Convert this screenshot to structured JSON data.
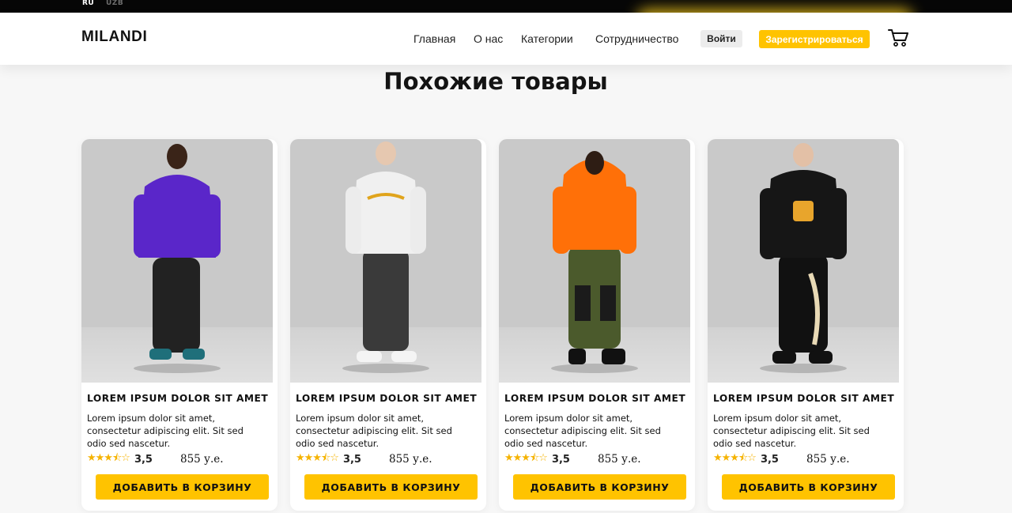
{
  "topbar": {
    "lang_ru": "RU",
    "lang_uz": "UZB"
  },
  "header": {
    "logo": "MILANDI",
    "nav": [
      "Главная",
      "О нас",
      "Категории",
      "Сотрудничество"
    ],
    "login_label": "Войти",
    "register_label": "Зарегистрироваться",
    "cart_icon": "shopping-cart-icon"
  },
  "colors": {
    "accent": "#ffc300",
    "star": "#f5b301",
    "topbar": "#060606"
  },
  "section": {
    "title": "Похожие товары"
  },
  "products": [
    {
      "image_desc": "purple hoodie",
      "title": "LOREM IPSUM DOLOR SIT AMET",
      "description": "Lorem ipsum dolor sit amet, consectetur adipiscing elit. Sit sed odio sed nascetur.",
      "stars": "★★★⯪☆",
      "rating": "3,5",
      "price": "855 у.е.",
      "button": "ДОБАВИТЬ В КОРЗИНУ"
    },
    {
      "image_desc": "white hoodie",
      "title": "LOREM IPSUM DOLOR SIT AMET",
      "description": "Lorem ipsum dolor sit amet, consectetur adipiscing elit. Sit sed odio sed nascetur.",
      "stars": "★★★⯪☆",
      "rating": "3,5",
      "price": "855 у.е.",
      "button": "ДОБАВИТЬ В КОРЗИНУ"
    },
    {
      "image_desc": "orange hoodie",
      "title": "LOREM IPSUM DOLOR SIT AMET",
      "description": "Lorem ipsum dolor sit amet, consectetur adipiscing elit. Sit sed odio sed nascetur.",
      "stars": "★★★⯪☆",
      "rating": "3,5",
      "price": "855 у.е.",
      "button": "ДОБАВИТЬ В КОРЗИНУ"
    },
    {
      "image_desc": "black hoodie",
      "title": "LOREM IPSUM DOLOR SIT AMET",
      "description": "Lorem ipsum dolor sit amet, consectetur adipiscing elit. Sit sed odio sed nascetur.",
      "stars": "★★★⯪☆",
      "rating": "3,5",
      "price": "855 у.е.",
      "button": "ДОБАВИТЬ В КОРЗИНУ"
    }
  ]
}
